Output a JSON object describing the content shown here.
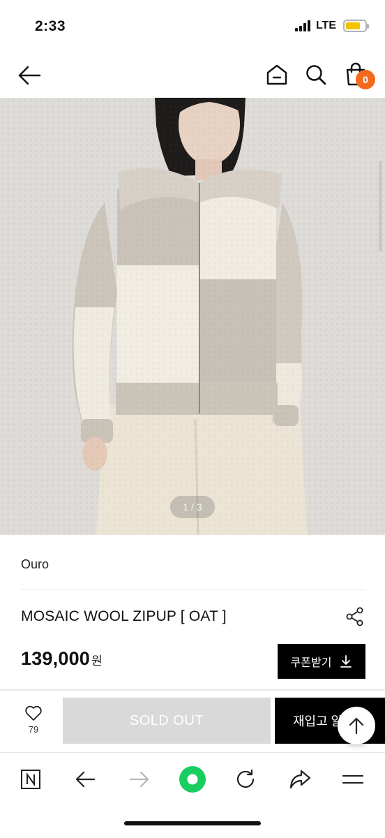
{
  "status_bar": {
    "time": "2:33",
    "network": "LTE",
    "battery_level": 0.75,
    "battery_color": "#f5c400"
  },
  "header": {
    "icons": [
      "back-arrow-icon",
      "home-icon",
      "search-icon",
      "shopping-bag-icon"
    ],
    "cart_count": "0",
    "badge_color": "#f26a1b"
  },
  "gallery": {
    "pager": "1 / 3"
  },
  "product": {
    "brand": "Ouro",
    "title": "MOSAIC WOOL ZIPUP [ OAT ]",
    "price": "139,000",
    "currency": "원",
    "coupon_label": "쿠폰받기"
  },
  "actions": {
    "like_count": "79",
    "sold_out_label": "SOLD OUT",
    "restock_label": "재입고 알림"
  },
  "browser_nav": {
    "icons": [
      "naver-n-icon",
      "back-icon",
      "forward-icon",
      "green-home-icon",
      "refresh-icon",
      "share-icon",
      "menu-icon"
    ]
  }
}
